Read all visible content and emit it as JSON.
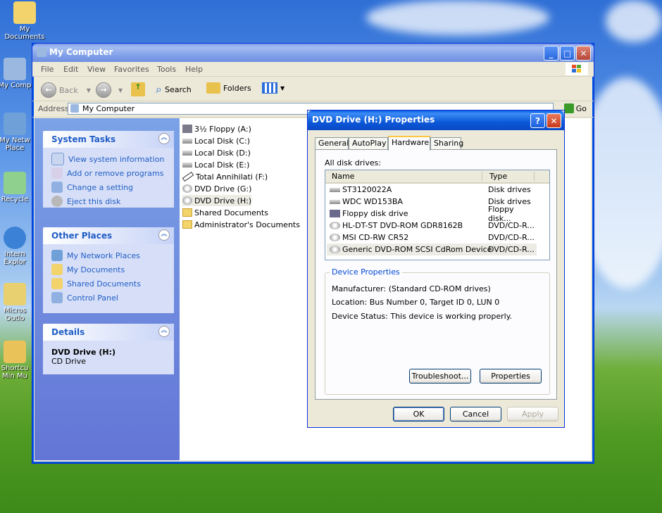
{
  "desktop": {
    "icons": [
      {
        "label": "My Documents"
      },
      {
        "label": "My Comp"
      },
      {
        "label": "My Netw Place"
      },
      {
        "label": "Recycle"
      },
      {
        "label": "Intern Explor"
      },
      {
        "label": "Micros Outlo"
      },
      {
        "label": "Shortcu Min Mu"
      }
    ]
  },
  "explorer": {
    "title": "My Computer",
    "menu": [
      "File",
      "Edit",
      "View",
      "Favorites",
      "Tools",
      "Help"
    ],
    "toolbar": {
      "back": "Back",
      "search": "Search",
      "folders": "Folders"
    },
    "address": {
      "label": "Address",
      "value": "My Computer",
      "go": "Go"
    },
    "panels": {
      "system_tasks": {
        "title": "System Tasks",
        "items": [
          "View system information",
          "Add or remove programs",
          "Change a setting",
          "Eject this disk"
        ]
      },
      "other_places": {
        "title": "Other Places",
        "items": [
          "My Network Places",
          "My Documents",
          "Shared Documents",
          "Control Panel"
        ]
      },
      "details": {
        "title": "Details",
        "name": "DVD Drive (H:)",
        "type": "CD Drive"
      }
    },
    "files": [
      "3½ Floppy (A:)",
      "Local Disk (C:)",
      "Local Disk (D:)",
      "Local Disk (E:)",
      "Total Annihilati (F:)",
      "DVD Drive (G:)",
      "DVD Drive (H:)",
      "Shared Documents",
      "Administrator's Documents"
    ]
  },
  "dialog": {
    "title": "DVD Drive (H:) Properties",
    "help_glyph": "?",
    "tabs": [
      "General",
      "AutoPlay",
      "Hardware",
      "Sharing"
    ],
    "all_drives_label": "All disk drives:",
    "columns": {
      "name": "Name",
      "type": "Type"
    },
    "drives": [
      {
        "name": "ST3120022A",
        "type": "Disk drives"
      },
      {
        "name": "WDC WD153BA",
        "type": "Disk drives"
      },
      {
        "name": "Floppy disk drive",
        "type": "Floppy disk..."
      },
      {
        "name": "HL-DT-ST DVD-ROM GDR8162B",
        "type": "DVD/CD-R..."
      },
      {
        "name": "MSI CD-RW CR52",
        "type": "DVD/CD-R..."
      },
      {
        "name": "Generic DVD-ROM SCSI CdRom Device",
        "type": "DVD/CD-R..."
      }
    ],
    "device_properties": {
      "title": "Device Properties",
      "manufacturer": "Manufacturer: (Standard CD-ROM drives)",
      "location": "Location: Bus Number 0, Target ID 0, LUN 0",
      "status": "Device Status: This device is working properly."
    },
    "buttons": {
      "troubleshoot": "Troubleshoot...",
      "properties": "Properties",
      "ok": "OK",
      "cancel": "Cancel",
      "apply": "Apply"
    }
  }
}
